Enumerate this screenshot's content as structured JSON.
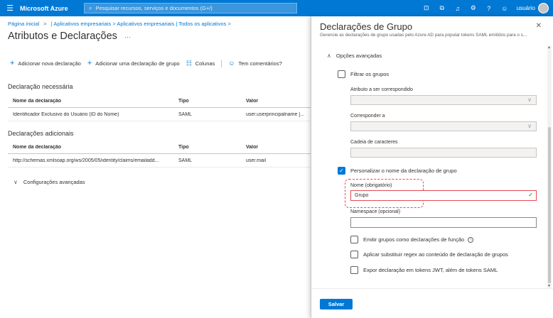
{
  "topbar": {
    "brand": "Microsoft Azure",
    "search_placeholder": "Pesquisar recursos, serviços e documentos (G+/)",
    "user": "usuário"
  },
  "breadcrumb": {
    "home": "Página inicial",
    "apps": "| Aplicativos empresariais > Aplicativos empresariais | Todos os aplicativos >"
  },
  "main": {
    "title": "Atributos e Declarações",
    "more": "···",
    "toolbar": {
      "add_claim": "Adicionar nova declaração",
      "add_group_claim": "Adicionar uma declaração de grupo",
      "columns": "Colunas",
      "feedback": "Tem comentários?"
    },
    "required_section": "Declaração necessária",
    "additional_section": "Declarações adicionais",
    "columns": [
      "Nome da declaração",
      "Tipo",
      "Valor"
    ],
    "required_rows": [
      [
        "Identificador Exclusivo do Usuário (ID do Nome)",
        "SAML",
        "user.userprincipalname [..."
      ]
    ],
    "additional_rows": [
      [
        "http://schemas.xmlsoap.org/ws/2005/05/identity/claims/emailadd...",
        "SAML",
        "user.mail"
      ]
    ],
    "advanced_settings": "Configurações avançadas"
  },
  "panel": {
    "title": "Declarações de Grupo",
    "subtitle": "Gerencie as declarações de grupo usadas pelo Azure AD para popular tokens SAML emitidos para o s...",
    "advanced_options": "Opções avançadas",
    "filter_groups": "Filtrar os grupos",
    "attribute_label": "Atributo a ser correspondido",
    "match_label": "Corresponder a",
    "string_label": "Cadeia de caracteres",
    "customize_name": "Personalizar o nome da declaração de grupo",
    "name_label": "Nome (obrigatório)",
    "name_value": "Grupo",
    "namespace_label": "Namespace (opcional)",
    "emit_roles": "Emitir grupos como declarações de função",
    "apply_regex": "Aplicar substituir regex ao conteúdo de declaração de grupos",
    "expose_jwt": "Expor declaração em tokens JWT, além de tokens SAML",
    "save": "Salvar"
  },
  "colors": {
    "accent": "#0078d4",
    "highlight": "#e74856",
    "success": "#107c10"
  }
}
